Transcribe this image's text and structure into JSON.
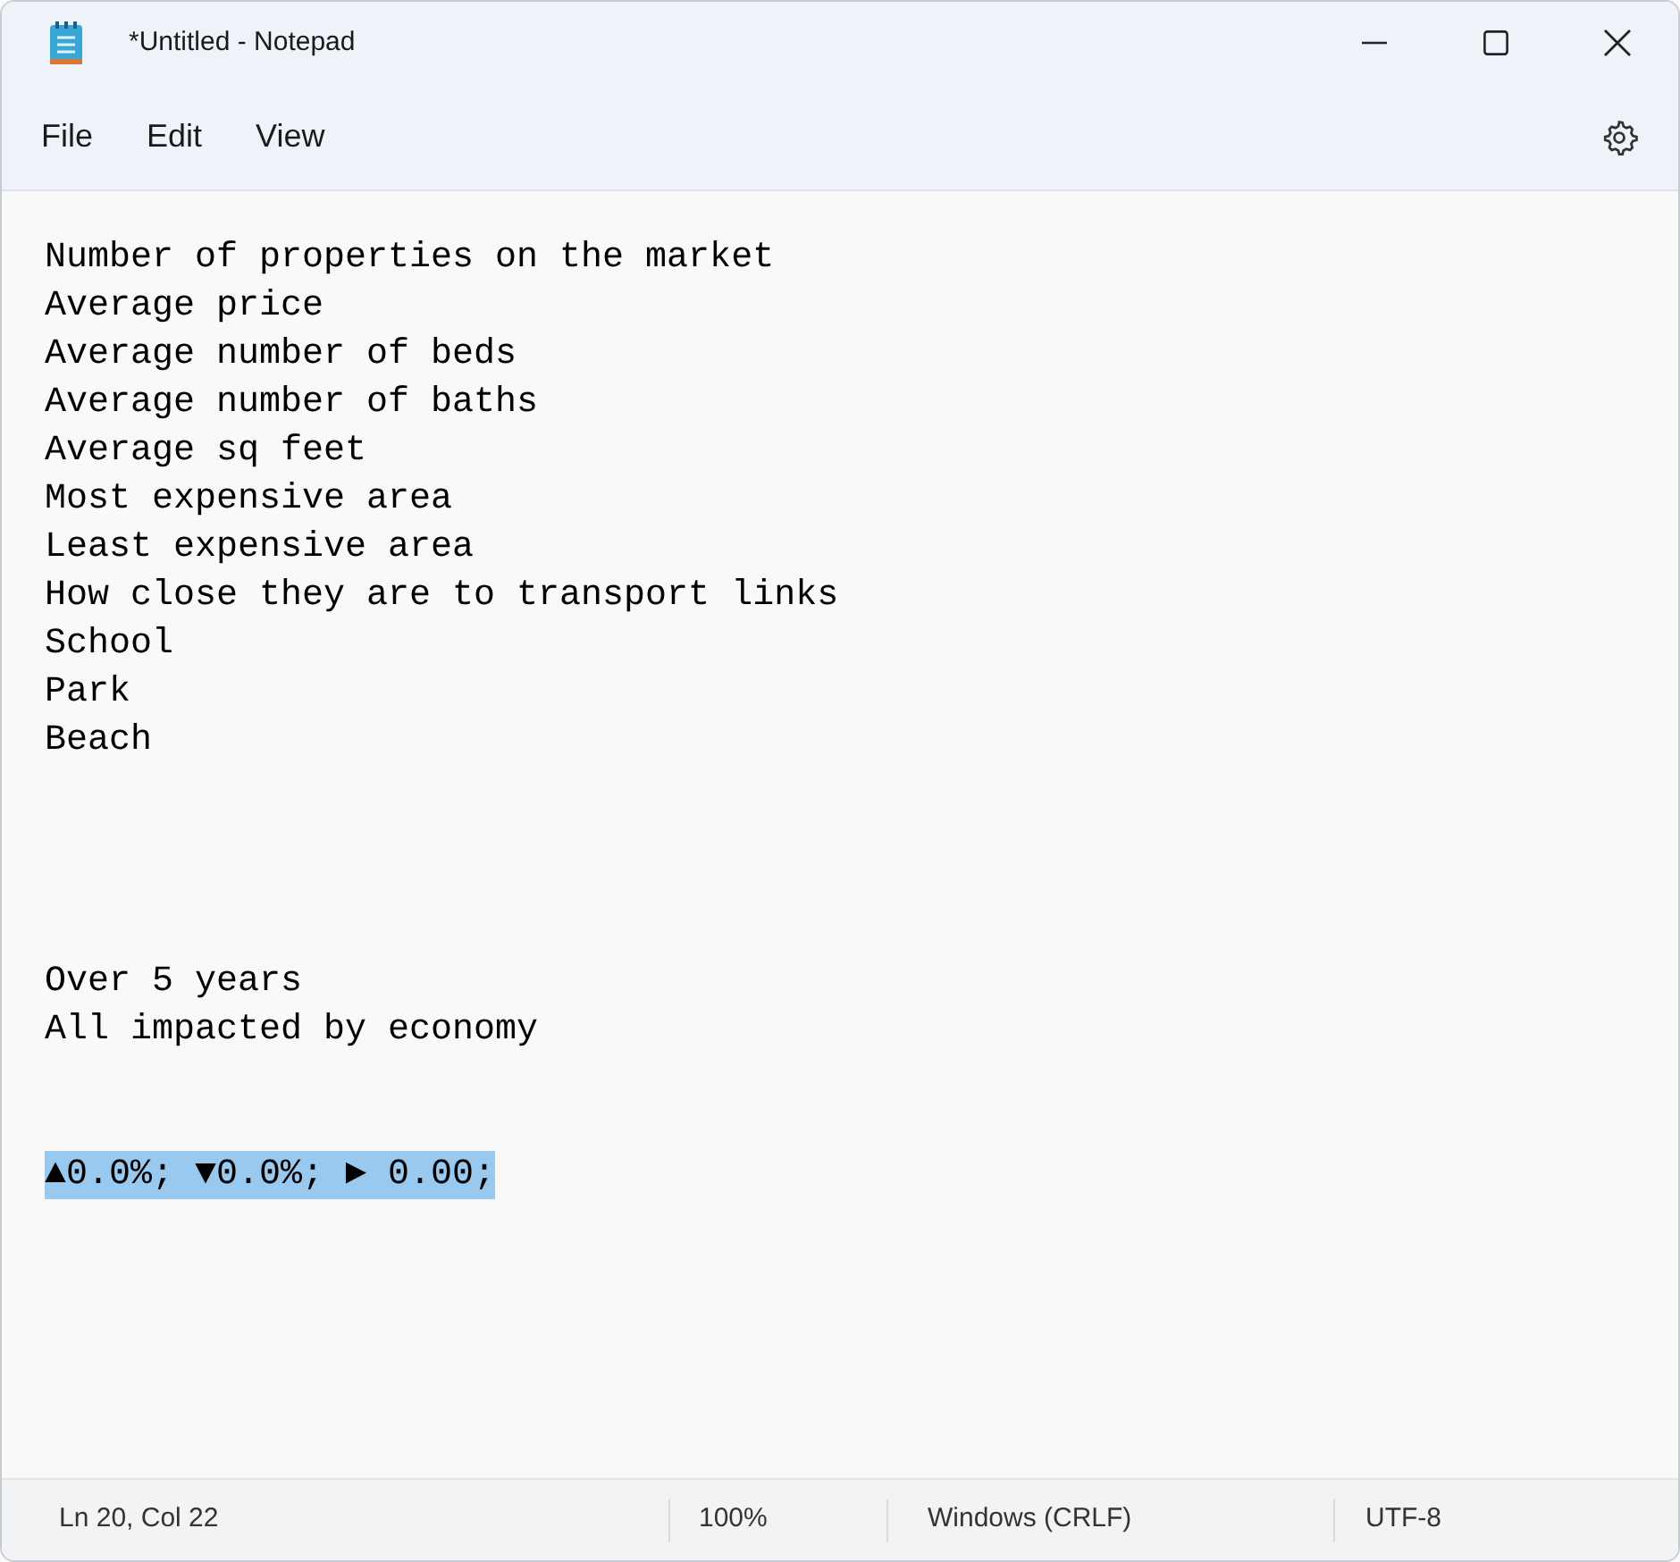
{
  "window": {
    "title": "*Untitled - Notepad"
  },
  "menu": [
    {
      "label": "File"
    },
    {
      "label": "Edit"
    },
    {
      "label": "View"
    }
  ],
  "document": {
    "text": "Number of properties on the market\nAverage price\nAverage number of beds\nAverage number of baths\nAverage sq feet\nMost expensive area\nLeast expensive area\nHow close they are to transport links\nSchool\nPark\nBeach\n\n\n\n\nOver 5 years\nAll impacted by economy\n\n\n",
    "selection": "▲0.0%; ▼0.0%; ► 0.00;"
  },
  "status_bar": [
    {
      "text": "Ln 20, Col 22"
    },
    {
      "text": "100%"
    },
    {
      "text": "Windows (CRLF)"
    },
    {
      "text": "UTF-8"
    }
  ]
}
